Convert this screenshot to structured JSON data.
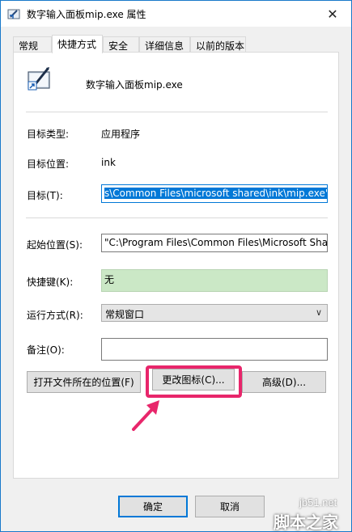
{
  "window": {
    "title": "数字输入面板mip.exe   属性",
    "close_glyph": "✕"
  },
  "tabs": [
    {
      "label": "常规"
    },
    {
      "label": "快捷方式"
    },
    {
      "label": "安全"
    },
    {
      "label": "详细信息"
    },
    {
      "label": "以前的版本"
    }
  ],
  "shortcut": {
    "name": "数字输入面板mip.exe",
    "target_type_label": "目标类型:",
    "target_type_value": "应用程序",
    "target_location_label": "目标位置:",
    "target_location_value": "ink",
    "target_label": "目标(T):",
    "target_value": "s\\Common Files\\microsoft shared\\ink\\mip.exe\"",
    "start_in_label": "起始位置(S):",
    "start_in_value": "\"C:\\Program Files\\Common Files\\Microsoft Sha",
    "hotkey_label": "快捷键(K):",
    "hotkey_value": "无",
    "run_label": "运行方式(R):",
    "run_value": "常规窗口",
    "comment_label": "备注(O):",
    "comment_value": "",
    "open_location_button": "打开文件所在的位置(F)",
    "change_icon_button": "更改图标(C)...",
    "advanced_button": "高级(D)..."
  },
  "footer": {
    "ok": "确定",
    "cancel": "取消"
  },
  "watermark": {
    "line1": "jb51.net",
    "line2": "脚本之家"
  },
  "colors": {
    "accent": "#0078d7",
    "highlight": "#e8266b",
    "hotkey_bg": "#cbe8c6"
  }
}
